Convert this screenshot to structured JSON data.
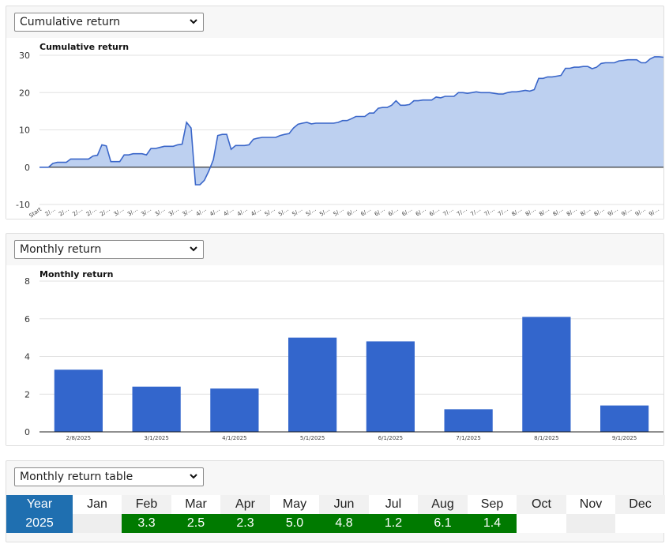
{
  "panels": {
    "cumulative": {
      "select_label": "Cumulative return"
    },
    "monthly": {
      "select_label": "Monthly return"
    },
    "table": {
      "select_label": "Monthly return table"
    }
  },
  "colors": {
    "line": "#3a66c9",
    "area": "#bdd0f0",
    "bar": "#3366cc",
    "year_header": "#1f6fb0",
    "positive": "#007a00"
  },
  "chart_data": [
    {
      "type": "area",
      "title": "Cumulative return",
      "xlabel": "",
      "ylabel": "",
      "ylim": [
        -10,
        30
      ],
      "yticks": [
        -10,
        0,
        10,
        20,
        30
      ],
      "grid": true,
      "first_tick_label": "Start",
      "x_tick_count": 46,
      "x_tick_prefixes": [
        "2/",
        "2/",
        "2/",
        "2/",
        "2/",
        "3/",
        "3/",
        "3/",
        "3/",
        "3/",
        "3/",
        "4/",
        "4/",
        "4/",
        "4/",
        "4/",
        "5/",
        "5/",
        "5/",
        "5/",
        "5/",
        "5/",
        "6/",
        "6/",
        "6/",
        "6/",
        "6/",
        "6/",
        "6/",
        "7/",
        "7/",
        "7/",
        "7/",
        "7/",
        "8/",
        "8/",
        "8/",
        "8/",
        "8/",
        "8/",
        "8/",
        "9/",
        "9/",
        "9/",
        "9/",
        "9/"
      ],
      "values": [
        0,
        0,
        0,
        1,
        1.3,
        1.3,
        1.3,
        2.2,
        2.2,
        2.2,
        2.2,
        2.2,
        3,
        3.2,
        6,
        5.7,
        1.5,
        1.5,
        1.5,
        3.3,
        3.3,
        3.6,
        3.6,
        3.6,
        3.3,
        5,
        5,
        5.3,
        5.6,
        5.6,
        5.6,
        6,
        6.2,
        12,
        10.5,
        -4.7,
        -4.7,
        -3.5,
        -1,
        2,
        8.5,
        8.8,
        8.8,
        4.8,
        5.8,
        5.8,
        5.8,
        6,
        7.5,
        7.8,
        8,
        8,
        8,
        8,
        8.5,
        8.8,
        9,
        10.5,
        11.5,
        11.8,
        12,
        11.6,
        11.8,
        11.8,
        11.8,
        11.8,
        11.8,
        12,
        12.5,
        12.5,
        13,
        13.6,
        13.6,
        13.6,
        14.5,
        14.5,
        15.8,
        16,
        16,
        16.6,
        17.8,
        16.6,
        16.6,
        16.8,
        17.8,
        17.8,
        18,
        18,
        18,
        18.8,
        18.6,
        19,
        19,
        19,
        20,
        20,
        19.8,
        20,
        20.2,
        20,
        20,
        20,
        19.8,
        19.6,
        19.6,
        20,
        20.2,
        20.2,
        20.4,
        20.6,
        20.4,
        20.8,
        23.8,
        23.8,
        24.2,
        24.2,
        24.4,
        24.6,
        26.5,
        26.5,
        26.8,
        26.8,
        27,
        27,
        26.4,
        26.8,
        27.8,
        28,
        28,
        28,
        28.5,
        28.6,
        28.8,
        28.8,
        28.8,
        28,
        28,
        29,
        29.6,
        29.6,
        29.5
      ]
    },
    {
      "type": "bar",
      "title": "Monthly return",
      "xlabel": "",
      "ylabel": "",
      "ylim": [
        0,
        8
      ],
      "yticks": [
        0,
        2,
        4,
        6,
        8
      ],
      "grid": true,
      "categories": [
        "2/8/2025",
        "3/1/2025",
        "4/1/2025",
        "5/1/2025",
        "6/1/2025",
        "7/1/2025",
        "8/1/2025",
        "9/1/2025"
      ],
      "values": [
        3.3,
        2.4,
        2.3,
        5.0,
        4.8,
        1.2,
        6.1,
        1.4
      ]
    },
    {
      "type": "table",
      "columns": [
        "Year",
        "Jan",
        "Feb",
        "Mar",
        "Apr",
        "May",
        "Jun",
        "Jul",
        "Aug",
        "Sep",
        "Oct",
        "Nov",
        "Dec"
      ],
      "rows": [
        {
          "year": "2025",
          "cells": [
            "",
            "3.3",
            "2.5",
            "2.3",
            "5.0",
            "4.8",
            "1.2",
            "6.1",
            "1.4",
            "",
            "",
            ""
          ]
        }
      ]
    }
  ]
}
